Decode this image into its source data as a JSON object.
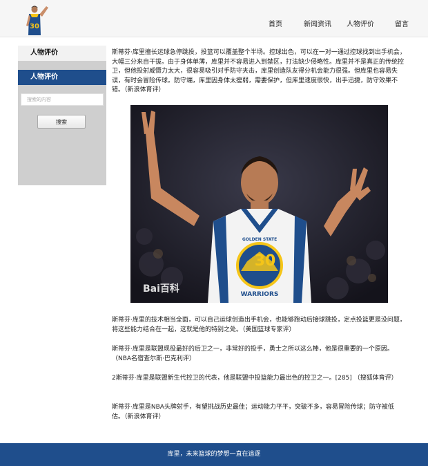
{
  "header": {
    "logo_icon": "player-logo-icon",
    "nav": [
      {
        "label": "首页"
      },
      {
        "label": "新闻资讯"
      },
      {
        "label": "人物评价"
      },
      {
        "label": "留言"
      }
    ]
  },
  "sidebar": {
    "title": "人物评价",
    "active_item": "人物评价",
    "search_placeholder": "搜索的内容",
    "search_button": "搜索"
  },
  "content": {
    "paragraphs": [
      "斯蒂芬·库里擅长运球急停跳投，投篮可以覆盖整个半场。控球出色，可以在一对一通过控球找到出手机会，大幅三分来自干拔。由于身体单薄，库里并不容易进入到禁区，打法缺少侵略性。库里并不是真正的传统控卫，但他投射威慑力太大，很容易吸引对手防守夹击，库里创造队友得分机会能力很强。但库里也容易失误，有时会冒险传球。防守端，库里因身体太瘦弱，需要保护，但库里速度很快，出手迅捷，防守效果不错。（新浪体育评）",
      "斯蒂芬·库里的技术相当全面，可以自己运球创造出手机会，也能够跑动后接球跳投，定点投篮更是没问题，将这些能力结合在一起，这就是他的特别之处。（美国篮球专家评）",
      "斯蒂芬·库里是联盟现役最好的后卫之一，非常好的投手，勇士之所以这么棒，他是很重要的一个原因。（NBA名宿查尔斯·巴克利评）",
      "2斯蒂芬·库里是联盟新生代控卫的代表，他是联盟中投篮能力最出色的控卫之一。[285] （搜狐体育评）",
      "斯蒂芬·库里是NBA头牌射手，有望挑战历史最佳；运动能力平平，突破不多，容易冒险传球；防守被低估。（新浪体育评）"
    ],
    "photo": {
      "jersey_team": "GOLDEN STATE",
      "jersey_name": "WARRIORS",
      "jersey_number": "30",
      "watermark": "Bai百科"
    }
  },
  "footer": {
    "text": "库里，未来篮球的梦想一直在追逐"
  },
  "colors": {
    "brand_blue": "#1f4e8c",
    "sidebar_gray": "#cfcfcf",
    "jersey_gold": "#f5c518"
  }
}
